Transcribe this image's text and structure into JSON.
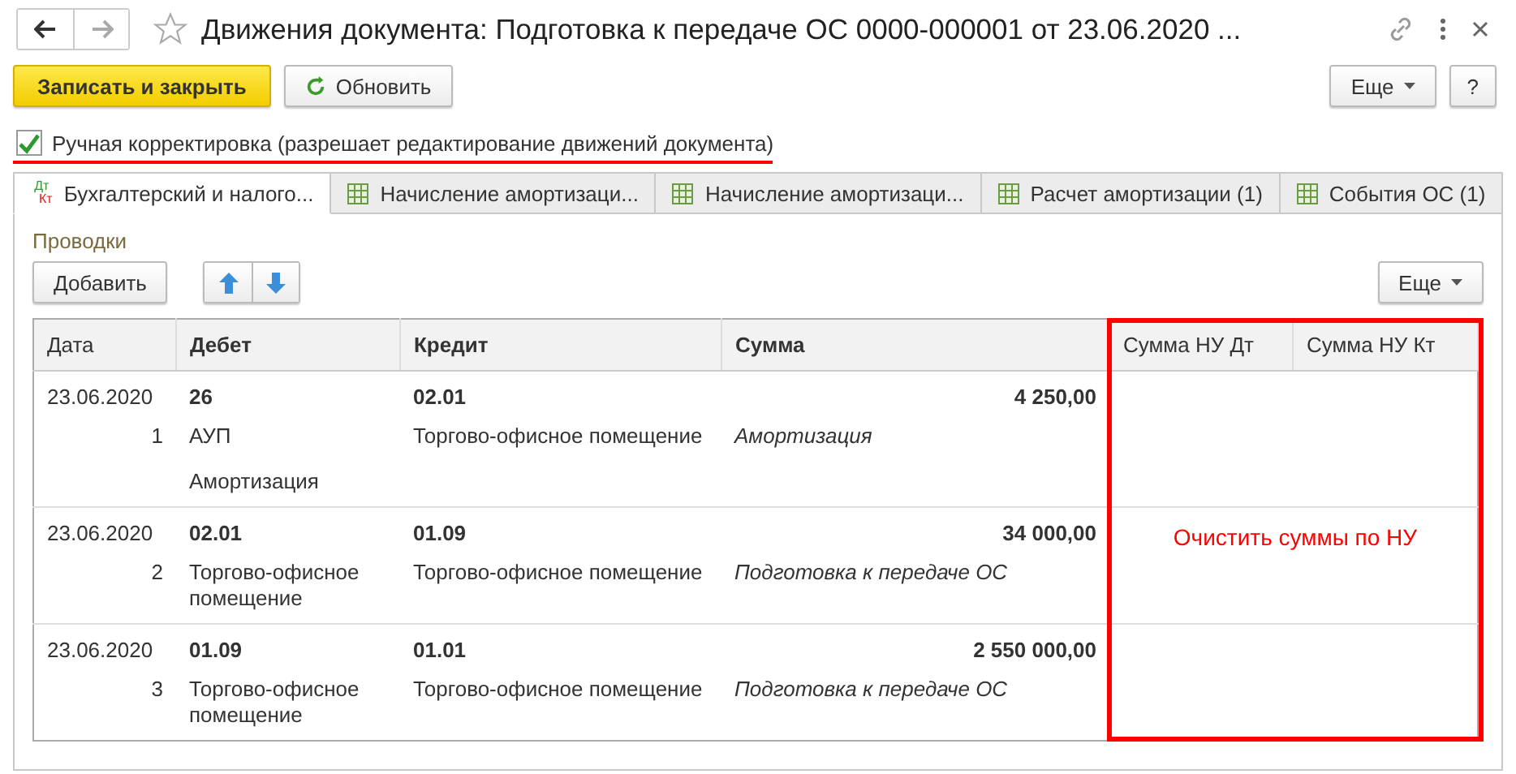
{
  "window": {
    "title": "Движения документа: Подготовка к передаче ОС 0000-000001 от 23.06.2020 ...",
    "starred": false
  },
  "toolbar": {
    "primary_button": "Записать и закрыть",
    "refresh_button": "Обновить",
    "more_button": "Еще",
    "help_button": "?"
  },
  "manual_edit": {
    "label": "Ручная корректировка (разрешает редактирование движений документа)",
    "checked": true
  },
  "tabs": [
    {
      "kind": "dtkt",
      "icon_text": [
        "Дт",
        "Кт"
      ],
      "label": "Бухгалтерский и налого...",
      "selected": true
    },
    {
      "kind": "table",
      "label": "Начисление амортизаци...",
      "selected": false
    },
    {
      "kind": "table",
      "label": "Начисление амортизаци...",
      "selected": false
    },
    {
      "kind": "table",
      "label": "Расчет амортизации (1)",
      "selected": false
    },
    {
      "kind": "table",
      "label": "События ОС (1)",
      "selected": false
    }
  ],
  "group_title": "Проводки",
  "panel_toolbar": {
    "add_button": "Добавить",
    "more_button": "Еще"
  },
  "table": {
    "columns": [
      "Дата",
      "Дебет",
      "Кредит",
      "Сумма",
      "Сумма НУ Дт",
      "Сумма НУ Кт"
    ],
    "rows": [
      {
        "date": "23.06.2020",
        "number": "1",
        "debit": "26",
        "debit_sub": [
          "АУП",
          "Амортизация"
        ],
        "credit": "02.01",
        "credit_sub": [
          "Торгово-офисное помещение"
        ],
        "amount": "4 250,00",
        "content": "Амортизация"
      },
      {
        "date": "23.06.2020",
        "number": "2",
        "debit": "02.01",
        "debit_sub": [
          "Торгово-офисное помещение"
        ],
        "credit": "01.09",
        "credit_sub": [
          "Торгово-офисное помещение"
        ],
        "amount": "34 000,00",
        "content": "Подготовка к передаче ОС"
      },
      {
        "date": "23.06.2020",
        "number": "3",
        "debit": "01.09",
        "debit_sub": [
          "Торгово-офисное помещение"
        ],
        "credit": "01.01",
        "credit_sub": [
          "Торгово-офисное помещение"
        ],
        "amount": "2 550 000,00",
        "content": "Подготовка к передаче ОС"
      }
    ]
  },
  "annotation": {
    "text": "Очистить суммы по НУ"
  }
}
